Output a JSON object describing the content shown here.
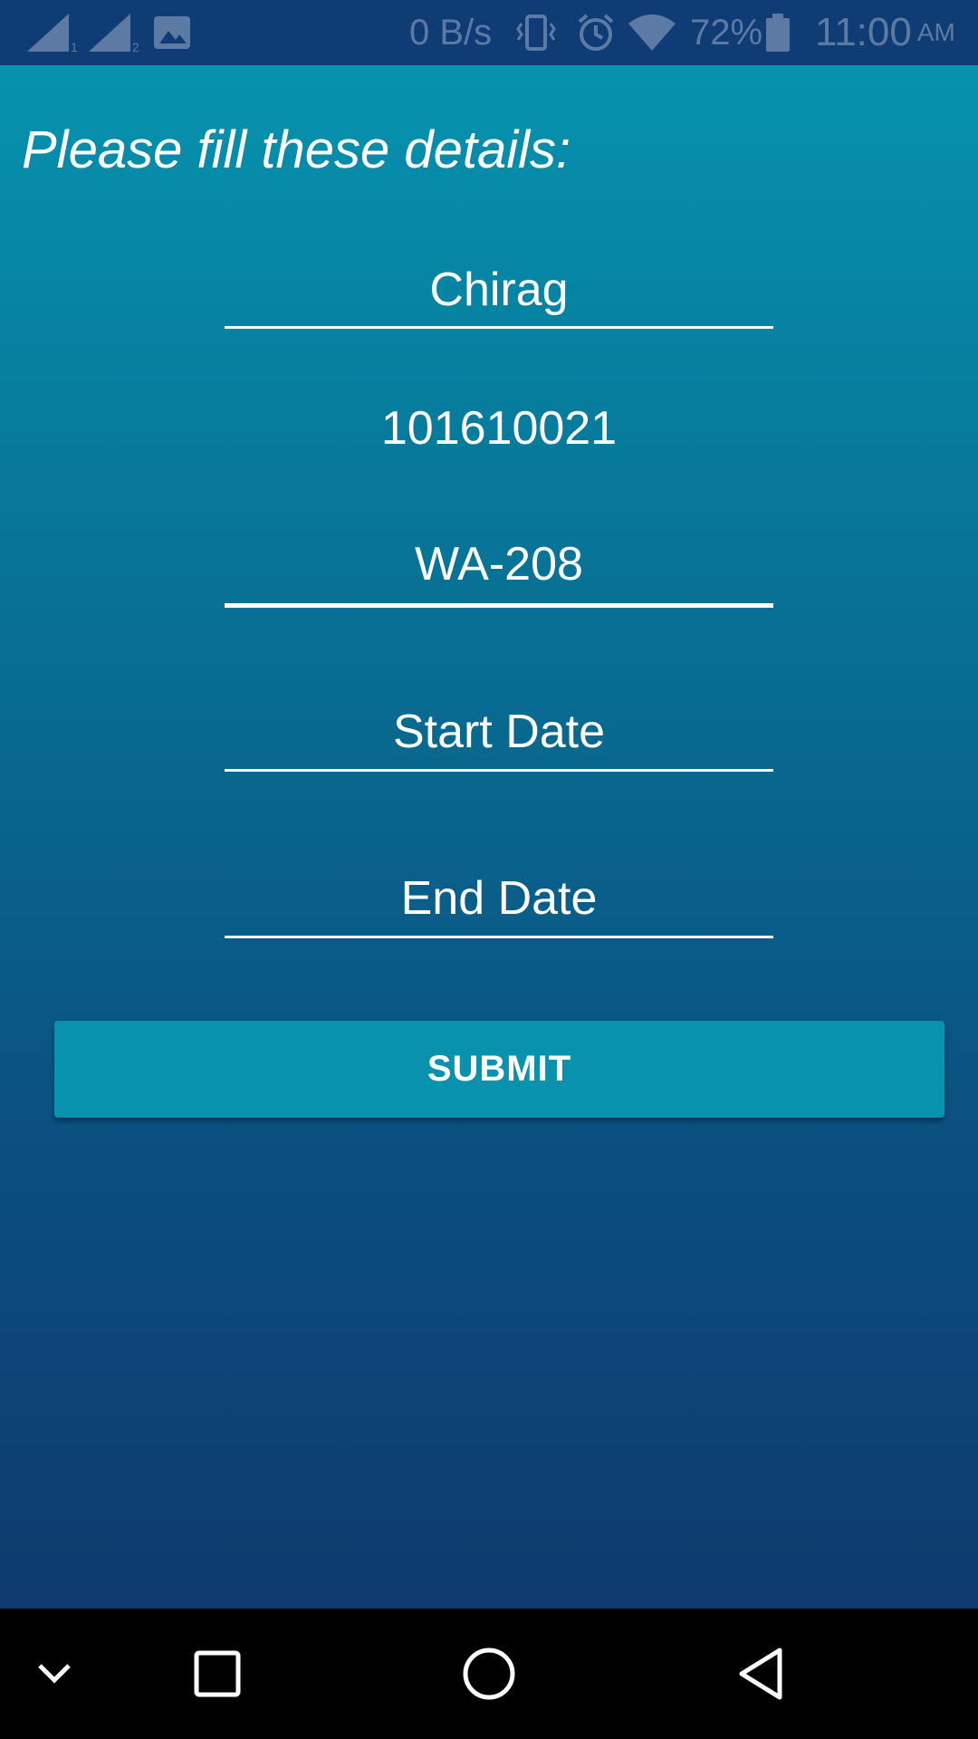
{
  "status_bar": {
    "data_speed": "0 B/s",
    "battery_percent": "72%",
    "time": "11:00",
    "time_suffix": "AM",
    "icons": [
      "signal-sim1-icon",
      "signal-sim2-icon",
      "gallery-icon",
      "vibrate-icon",
      "alarm-icon",
      "wifi-icon",
      "battery-icon"
    ],
    "color": "#103c75"
  },
  "form": {
    "heading": "Please fill these details:",
    "name_value": "Chirag",
    "id_value": "101610021",
    "room_value": "WA-208",
    "start_date_placeholder": "Start Date",
    "end_date_placeholder": "End Date",
    "submit_label": "SUBMIT",
    "button_color": "#0892ad"
  },
  "nav_bar": {
    "icons": [
      "chevron-down-icon",
      "recents-icon",
      "home-icon",
      "back-icon"
    ]
  }
}
